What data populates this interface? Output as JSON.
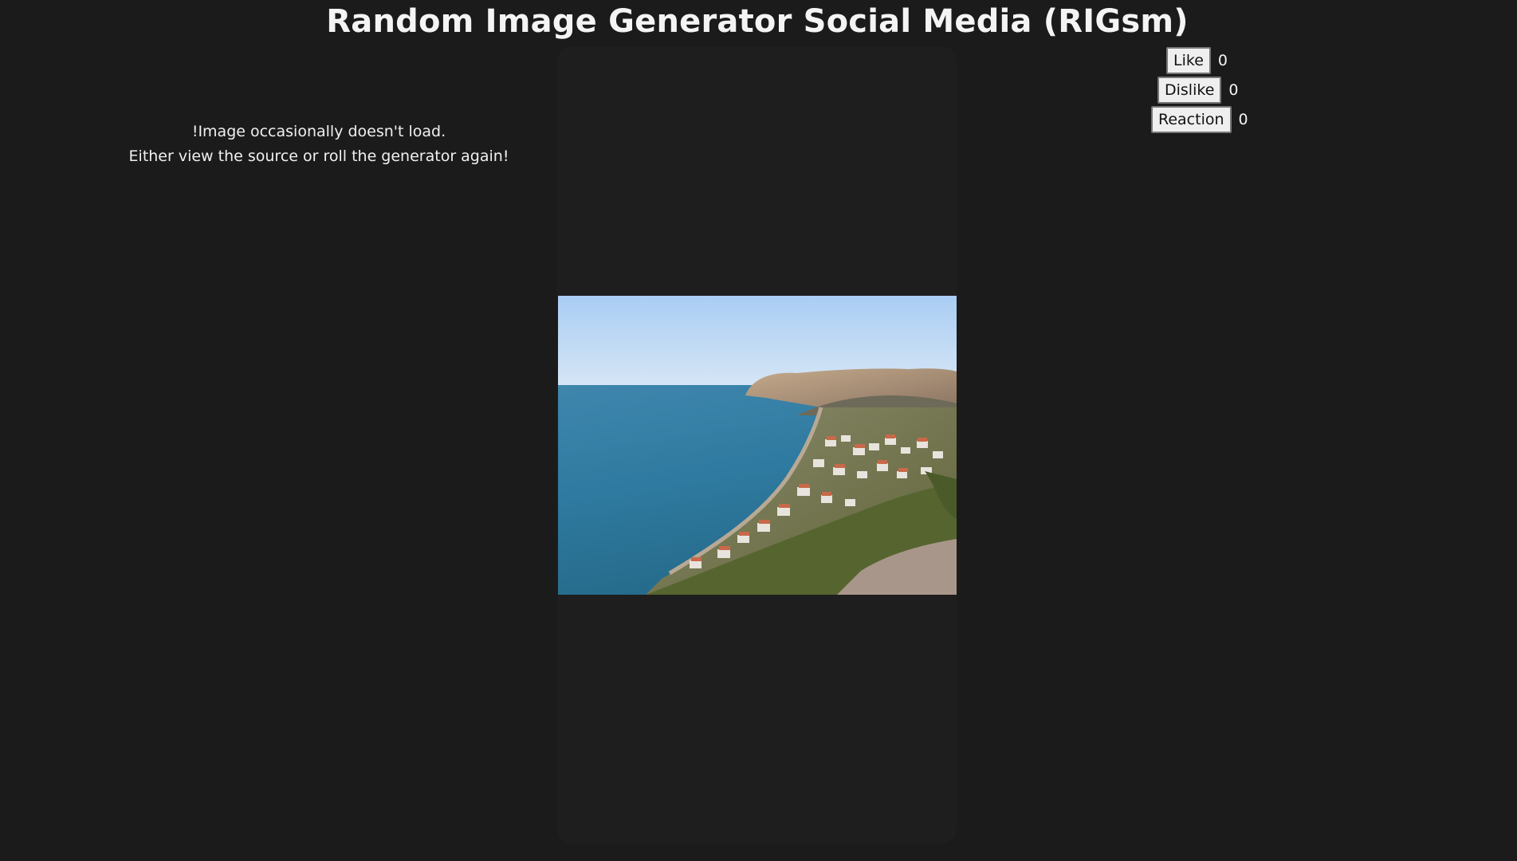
{
  "header": {
    "title": "Random Image Generator Social Media (RIGsm)"
  },
  "notice": {
    "line1": "!Image occasionally doesn't load.",
    "line2": "Either view the source or roll the generator again!"
  },
  "reactions": [
    {
      "label": "Like",
      "count": "0"
    },
    {
      "label": "Dislike",
      "count": "0"
    },
    {
      "label": "Reaction",
      "count": "0"
    }
  ],
  "colors": {
    "background": "#1b1b1b",
    "card": "#1e1e1e",
    "button": "#efefef"
  }
}
